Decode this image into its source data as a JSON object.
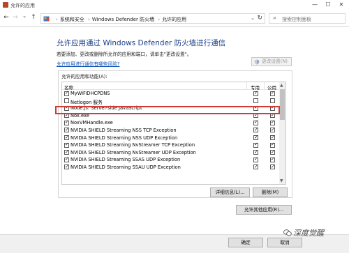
{
  "window": {
    "title": "允许的应用",
    "minimize": "—",
    "maximize": "☐",
    "close": "✕"
  },
  "nav": {
    "back": "←",
    "forward": "→",
    "up_dropdown": "⌄",
    "up": "↑",
    "breadcrumbs": [
      "系统和安全",
      "Windows Defender 防火墙",
      "允许的应用"
    ],
    "separator": "›",
    "address_dropdown": "⌄",
    "refresh": "↻",
    "search_placeholder": "搜索控制面板"
  },
  "main": {
    "heading": "允许应用通过 Windows Defender 防火墙进行通信",
    "description": "若要添加、更改或删除所允许的应用和端口，请单击\"更改设置\"。",
    "risk_link": "允许应用进行通信有哪些风险?",
    "change_settings": "更改设置(N)",
    "group_label": "允许的应用和功能(A):",
    "columns": {
      "name": "名称",
      "private": "专用",
      "public": "公用"
    },
    "rows": [
      {
        "name": "MyWiFiDHCPDNS",
        "enabled": true,
        "private": true,
        "public": true
      },
      {
        "name": "Netlogon 服务",
        "enabled": false,
        "private": false,
        "public": false
      },
      {
        "name": "Node.js: Server-side JavaScript",
        "enabled": true,
        "private": true,
        "public": true
      },
      {
        "name": "Nox.exe",
        "enabled": true,
        "private": true,
        "public": true
      },
      {
        "name": "NoxVMHandle.exe",
        "enabled": true,
        "private": true,
        "public": true
      },
      {
        "name": "NVIDIA SHIELD Streaming NSS TCP Exception",
        "enabled": true,
        "private": true,
        "public": true
      },
      {
        "name": "NVIDIA SHIELD Streaming NSS UDP Exception",
        "enabled": true,
        "private": true,
        "public": true
      },
      {
        "name": "NVIDIA SHIELD Streaming NvStreamer TCP Exception",
        "enabled": true,
        "private": true,
        "public": true
      },
      {
        "name": "NVIDIA SHIELD Streaming NvStreamer UDP Exception",
        "enabled": true,
        "private": true,
        "public": true
      },
      {
        "name": "NVIDIA SHIELD Streaming SSAS UDP Exception",
        "enabled": true,
        "private": true,
        "public": true
      },
      {
        "name": "NVIDIA SHIELD Streaming SSAU UDP Exception",
        "enabled": true,
        "private": true,
        "public": true
      }
    ],
    "details": "详细信息(L)...",
    "delete": "删除(M)",
    "allow_other": "允许其他应用(R)..."
  },
  "footer": {
    "ok": "确定",
    "cancel": "取消"
  },
  "watermark": "深度觉醒",
  "colors": {
    "heading": "#1a3f8a",
    "link": "#0a50b4",
    "highlight": "#d43a34"
  }
}
